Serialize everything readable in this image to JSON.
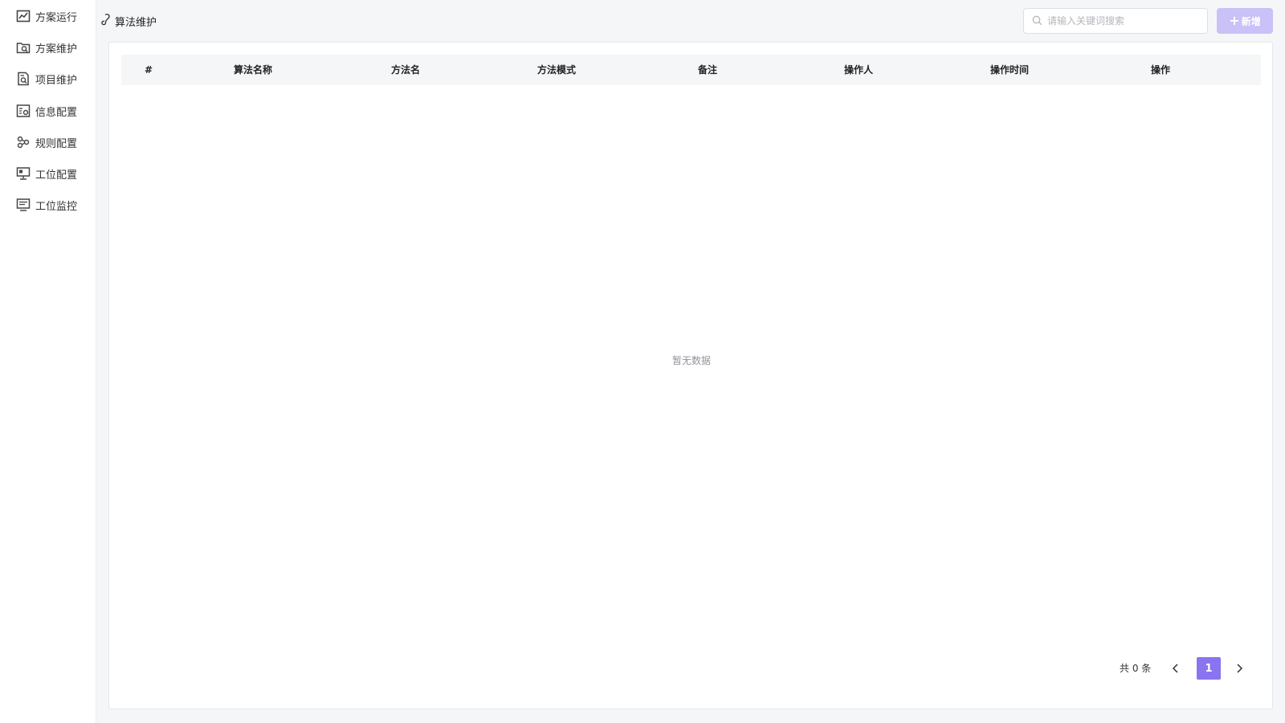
{
  "sidebar": {
    "items": [
      {
        "label": "方案运行",
        "icon": "trend-chart-icon"
      },
      {
        "label": "方案维护",
        "icon": "folder-search-icon"
      },
      {
        "label": "项目维护",
        "icon": "document-search-icon"
      },
      {
        "label": "信息配置",
        "icon": "info-settings-icon"
      },
      {
        "label": "规则配置",
        "icon": "rules-nodes-icon"
      },
      {
        "label": "工位配置",
        "icon": "workstation-monitor-icon"
      },
      {
        "label": "工位监控",
        "icon": "monitor-list-icon"
      }
    ]
  },
  "header": {
    "title": "算法维护",
    "title_icon": "algorithm-icon",
    "search_placeholder": "请输入关键词搜索",
    "add_label": "新增"
  },
  "table": {
    "columns": [
      "#",
      "算法名称",
      "方法名",
      "方法模式",
      "备注",
      "操作人",
      "操作时间",
      "操作"
    ],
    "rows": [],
    "empty_text": "暂无数据"
  },
  "pagination": {
    "total_text": "共 0 条",
    "current_page": "1"
  },
  "colors": {
    "accent": "#8a74f0",
    "accent_disabled": "#c9c1f7",
    "background": "#f5f6f8"
  }
}
